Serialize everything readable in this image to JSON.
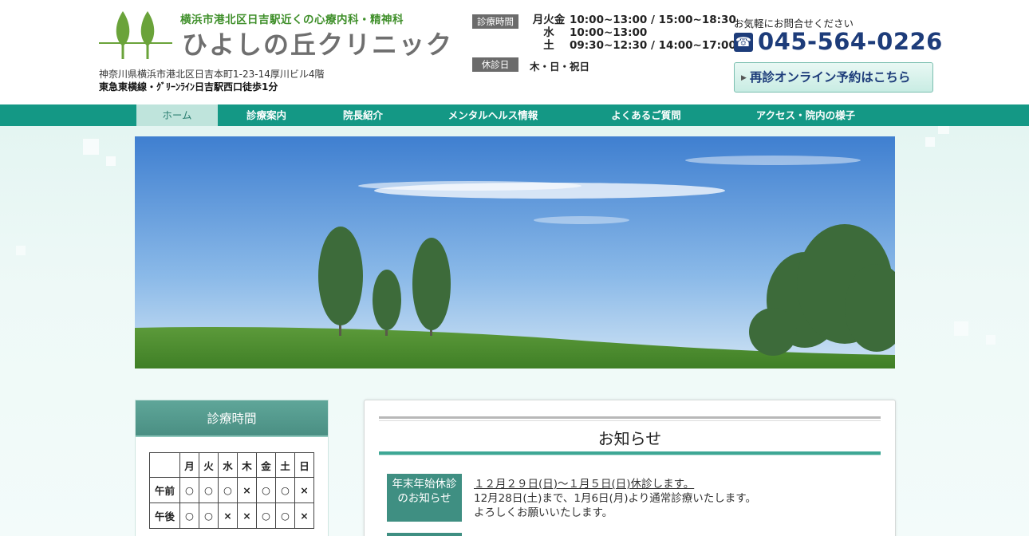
{
  "header": {
    "tagline": "横浜市港北区日吉駅近くの心療内科・精神科",
    "clinic_name": "ひよしの丘クリニック",
    "address": "神奈川県横浜市港北区日吉本町1-23-14厚川ビル4階",
    "access": "東急東横線・ｸﾞﾘｰﾝﾗｲﾝ日吉駅西口徒歩1分",
    "hours_label": "診療時間",
    "hours": [
      {
        "days": "月火金",
        "times": "10:00~13:00 / 15:00~18:30"
      },
      {
        "days": "水",
        "times": "10:00~13:00"
      },
      {
        "days": "土",
        "times": "09:30~12:30 / 14:00~17:00"
      }
    ],
    "closed_label": "休診日",
    "closed_days": "木・日・祝日",
    "contact_note": "お気軽にお問合せください",
    "phone_icon": "phone-icon",
    "phone": "045-564-0226",
    "reserve_button": "再診オンライン予約はこちら"
  },
  "nav": {
    "items": [
      "ホーム",
      "診療案内",
      "院長紹介",
      "メンタルヘルス情報",
      "よくあるご質問",
      "アクセス・院内の様子"
    ],
    "active": "ホーム"
  },
  "sidebar": {
    "title": "診療時間",
    "schedule": {
      "days": [
        "月",
        "火",
        "水",
        "木",
        "金",
        "土",
        "日"
      ],
      "rows": [
        {
          "label": "午前",
          "marks": [
            "○",
            "○",
            "○",
            "×",
            "○",
            "○",
            "×"
          ]
        },
        {
          "label": "午後",
          "marks": [
            "○",
            "○",
            "×",
            "×",
            "○",
            "○",
            "×"
          ]
        }
      ]
    }
  },
  "news": {
    "title": "お知らせ",
    "items": [
      {
        "label": "年末年始休診のお知らせ",
        "headline": "１２月２９日(日)～１月５日(日)休診します。",
        "lines": [
          "12月28日(土)まで、1月6日(月)より通常診療いたします。",
          "よろしくお願いいたします。"
        ]
      }
    ]
  },
  "colors": {
    "accent": "#149885",
    "brand_green": "#3f8f2a",
    "phone_blue": "#1d3c7a"
  }
}
